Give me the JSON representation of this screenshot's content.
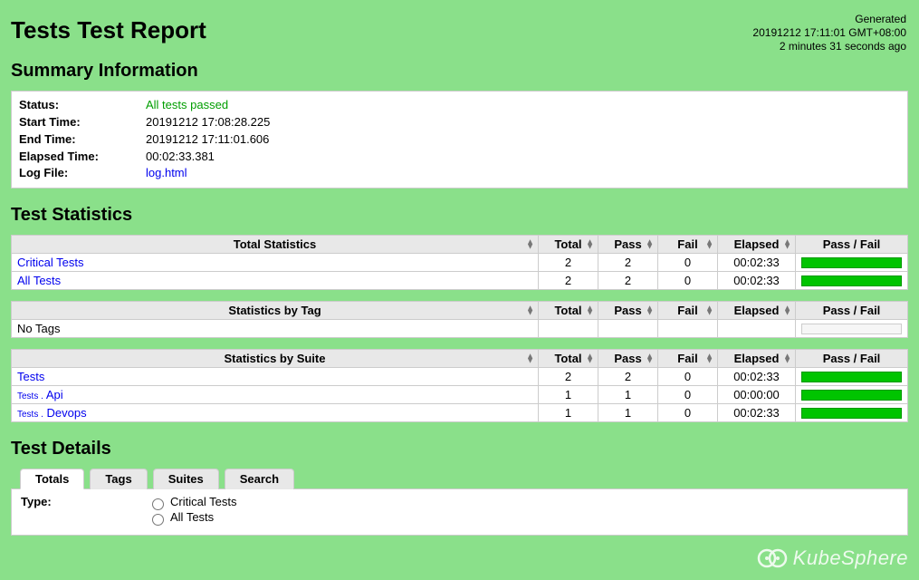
{
  "title": "Tests Test Report",
  "generated": {
    "label": "Generated",
    "timestamp": "20191212 17:11:01 GMT+08:00",
    "ago": "2 minutes 31 seconds ago"
  },
  "headings": {
    "summary": "Summary Information",
    "statistics": "Test Statistics",
    "details": "Test Details"
  },
  "summary": {
    "status_label": "Status:",
    "status_value": "All tests passed",
    "start_label": "Start Time:",
    "start_value": "20191212 17:08:28.225",
    "end_label": "End Time:",
    "end_value": "20191212 17:11:01.606",
    "elapsed_label": "Elapsed Time:",
    "elapsed_value": "00:02:33.381",
    "log_label": "Log File:",
    "log_value": "log.html"
  },
  "stats_headers": {
    "total": "Total",
    "pass": "Pass",
    "fail": "Fail",
    "elapsed": "Elapsed",
    "passfail": "Pass / Fail"
  },
  "total_stats": {
    "title": "Total Statistics",
    "rows": [
      {
        "name": "Critical Tests",
        "total": "2",
        "pass": "2",
        "fail": "0",
        "elapsed": "00:02:33"
      },
      {
        "name": "All Tests",
        "total": "2",
        "pass": "2",
        "fail": "0",
        "elapsed": "00:02:33"
      }
    ]
  },
  "tag_stats": {
    "title": "Statistics by Tag",
    "empty": "No Tags"
  },
  "suite_stats": {
    "title": "Statistics by Suite",
    "rows": [
      {
        "prefix": "",
        "name": "Tests",
        "total": "2",
        "pass": "2",
        "fail": "0",
        "elapsed": "00:02:33"
      },
      {
        "prefix": "Tests .",
        "name": "Api",
        "total": "1",
        "pass": "1",
        "fail": "0",
        "elapsed": "00:00:00"
      },
      {
        "prefix": "Tests .",
        "name": "Devops",
        "total": "1",
        "pass": "1",
        "fail": "0",
        "elapsed": "00:02:33"
      }
    ]
  },
  "details": {
    "tabs": [
      "Totals",
      "Tags",
      "Suites",
      "Search"
    ],
    "type_label": "Type:",
    "radios": [
      "Critical Tests",
      "All Tests"
    ]
  },
  "watermark": "KubeSphere"
}
